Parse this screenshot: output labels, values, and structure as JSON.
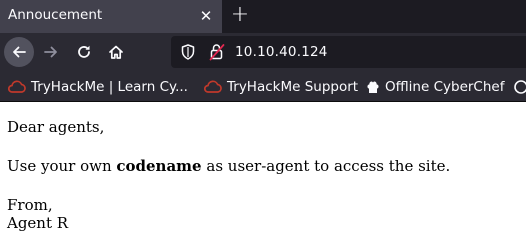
{
  "tab": {
    "title": "Annoucement",
    "close_symbol": "✕"
  },
  "new_tab_symbol": "+",
  "url": "10.10.40.124",
  "bookmarks": [
    {
      "label": "TryHackMe | Learn Cy..."
    },
    {
      "label": "TryHackMe Support"
    },
    {
      "label": "Offline CyberChef"
    }
  ],
  "page": {
    "greeting": "Dear agents,",
    "message_before": "Use your own ",
    "message_bold": "codename",
    "message_after": " as user-agent to access the site.",
    "signoff": "From,",
    "signature": "Agent R"
  },
  "colors": {
    "tab_strip": "#1c1b22",
    "toolbar": "#2b2a33",
    "active_tab": "#42414d",
    "urlbar": "#1c1b22",
    "bookmark_icon": "#c0392b"
  },
  "icons": [
    "back-icon",
    "forward-icon",
    "reload-icon",
    "home-icon",
    "shield-icon",
    "insecure-lock-icon",
    "thm-bookmark-icon",
    "chef-hat-icon"
  ]
}
